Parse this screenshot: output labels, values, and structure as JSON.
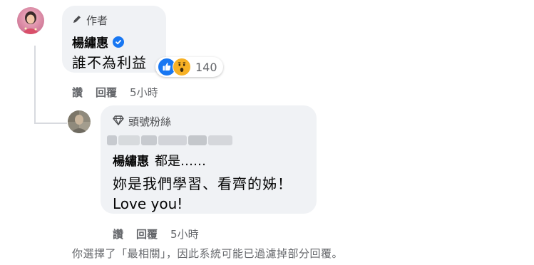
{
  "author_badge": {
    "icon": "pencil-icon",
    "label": "作者"
  },
  "comment": {
    "author": "楊繡惠",
    "verified": true,
    "text": "誰不為利益",
    "reactions": {
      "icons": [
        "like-icon",
        "wow-icon"
      ],
      "count": "140"
    },
    "actions": {
      "like": "讚",
      "reply": "回覆",
      "time": "5小時"
    }
  },
  "reply": {
    "badge": {
      "icon": "diamond-icon",
      "label": "頭號粉絲"
    },
    "mention": "楊繡惠",
    "line1": "都是……",
    "line2": "妳是我們學習、看齊的姊！",
    "line3": "Love you!",
    "actions": {
      "like": "讚",
      "reply": "回覆",
      "time": "5小時"
    }
  },
  "notice": "你選擇了「最相關」，因此系統可能已過濾掉部分回覆。",
  "colors": {
    "accent": "#1877f2",
    "bubble": "#f0f2f5",
    "muted": "#65676b",
    "wow": "#f7b125"
  }
}
